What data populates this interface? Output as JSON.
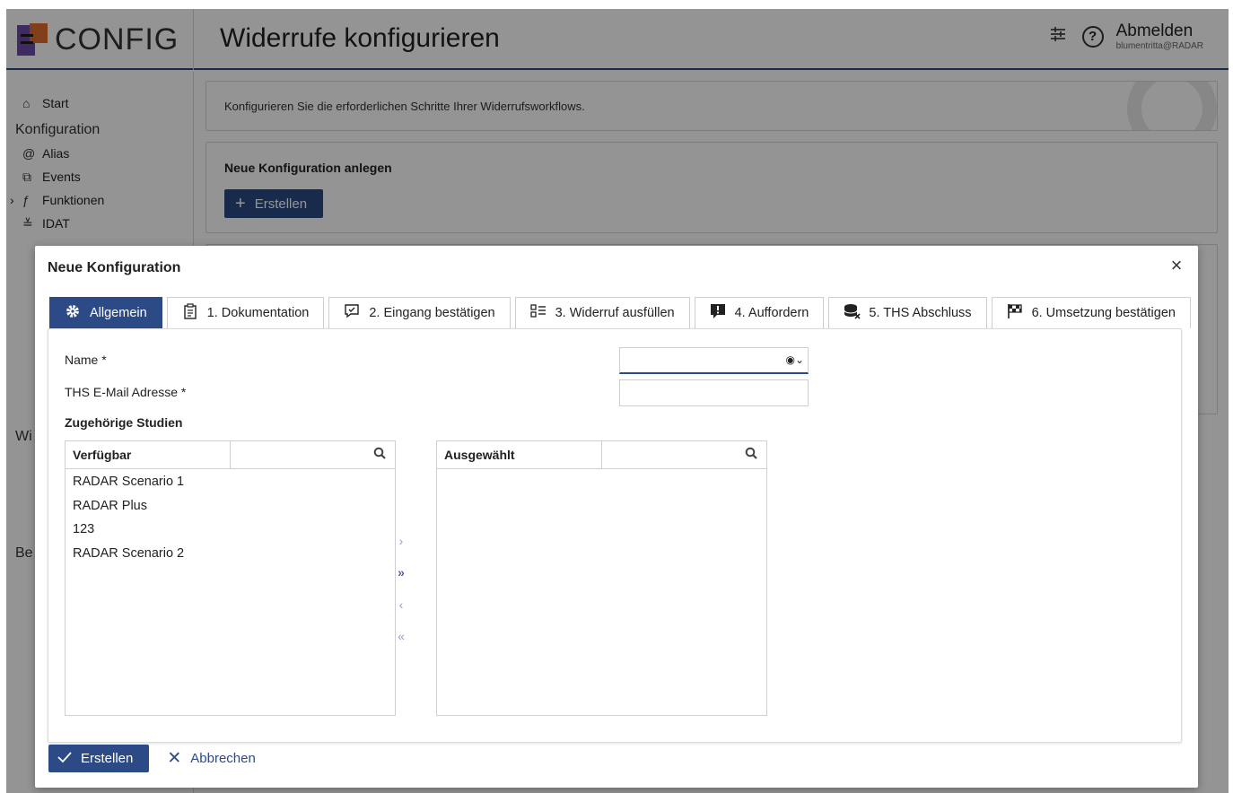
{
  "app": {
    "brand": "CONFIG",
    "page_title": "Widerrufe konfigurieren",
    "logout_label": "Abmelden",
    "user": "blumentritta@RADAR",
    "settings_icon": "sliders-icon",
    "help_icon": "help-circle-icon"
  },
  "sidebar": {
    "start": "Start",
    "section_konfiguration": "Konfiguration",
    "items": [
      {
        "label": "Alias",
        "icon": "@"
      },
      {
        "label": "Events",
        "icon": "⧉"
      },
      {
        "label": "Funktionen",
        "icon": "ƒ"
      },
      {
        "label": "IDAT",
        "icon": "≚"
      }
    ],
    "partial_section_1": "Wi",
    "partial_section_2": "Be"
  },
  "main": {
    "intro": "Konfigurieren Sie die erforderlichen Schritte Ihrer Widerrufsworkflows.",
    "new_config_title": "Neue Konfiguration anlegen",
    "create_button": "Erstellen"
  },
  "dialog": {
    "title": "Neue Konfiguration",
    "tabs": [
      {
        "label": "Allgemein",
        "icon": "gear-icon",
        "active": true
      },
      {
        "label": "1. Dokumentation",
        "icon": "clipboard-icon",
        "active": false
      },
      {
        "label": "2. Eingang bestätigen",
        "icon": "message-check-icon",
        "active": false
      },
      {
        "label": "3. Widerruf ausfüllen",
        "icon": "checklist-icon",
        "active": false
      },
      {
        "label": "4. Auffordern",
        "icon": "comment-exclamation-icon",
        "active": false
      },
      {
        "label": "5. THS Abschluss",
        "icon": "database-x-icon",
        "active": false
      },
      {
        "label": "6. Umsetzung bestätigen",
        "icon": "flag-checkered-icon",
        "active": false
      }
    ],
    "form": {
      "name_label": "Name *",
      "name_value": "",
      "email_label": "THS E-Mail Adresse *",
      "email_value": "",
      "studies_title": "Zugehörige Studien"
    },
    "available": {
      "header": "Verfügbar",
      "filter_value": "",
      "items": [
        "RADAR Scenario 1",
        "RADAR Plus",
        "123",
        "RADAR Scenario 2"
      ]
    },
    "selected": {
      "header": "Ausgewählt",
      "filter_value": "",
      "items": []
    },
    "movers": {
      "move_right": "›",
      "move_all_right": "»",
      "move_left": "‹",
      "move_all_left": "«"
    },
    "footer": {
      "submit_label": "Erstellen",
      "cancel_label": "Abbrechen"
    }
  }
}
